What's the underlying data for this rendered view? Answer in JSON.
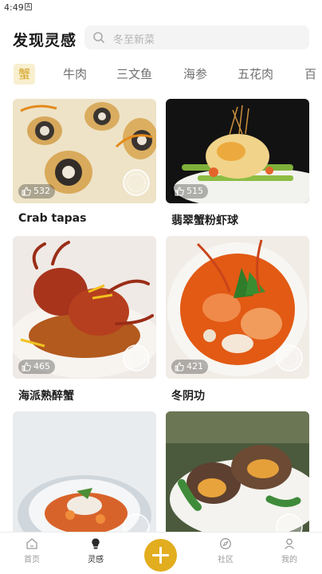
{
  "status_bar": {
    "time": "4:49",
    "notif_glyph": "A"
  },
  "header": {
    "title": "发现灵感",
    "search_placeholder": "冬至新菜"
  },
  "tabs": [
    {
      "label": "蟹",
      "active": true
    },
    {
      "label": "牛肉",
      "active": false
    },
    {
      "label": "三文鱼",
      "active": false
    },
    {
      "label": "海参",
      "active": false
    },
    {
      "label": "五花肉",
      "active": false
    },
    {
      "label": "百",
      "active": false
    }
  ],
  "cards": [
    {
      "name": "Crab tapas",
      "likes": "532"
    },
    {
      "name": "翡翠蟹粉虾球",
      "likes": "515"
    },
    {
      "name": "海派熟醉蟹",
      "likes": "465"
    },
    {
      "name": "冬阴功",
      "likes": "421"
    },
    {
      "name": "",
      "likes": ""
    },
    {
      "name": "",
      "likes": ""
    }
  ],
  "bottom_nav": [
    {
      "label": "首页",
      "icon": "home-icon"
    },
    {
      "label": "灵感",
      "icon": "lightbulb-icon"
    },
    {
      "label": "社区",
      "icon": "compass-icon"
    },
    {
      "label": "我的",
      "icon": "user-icon"
    }
  ],
  "colors": {
    "accent": "#e2ad1e",
    "tab_active_bg": "#f8efcf",
    "tab_active_text": "#d6a324"
  }
}
